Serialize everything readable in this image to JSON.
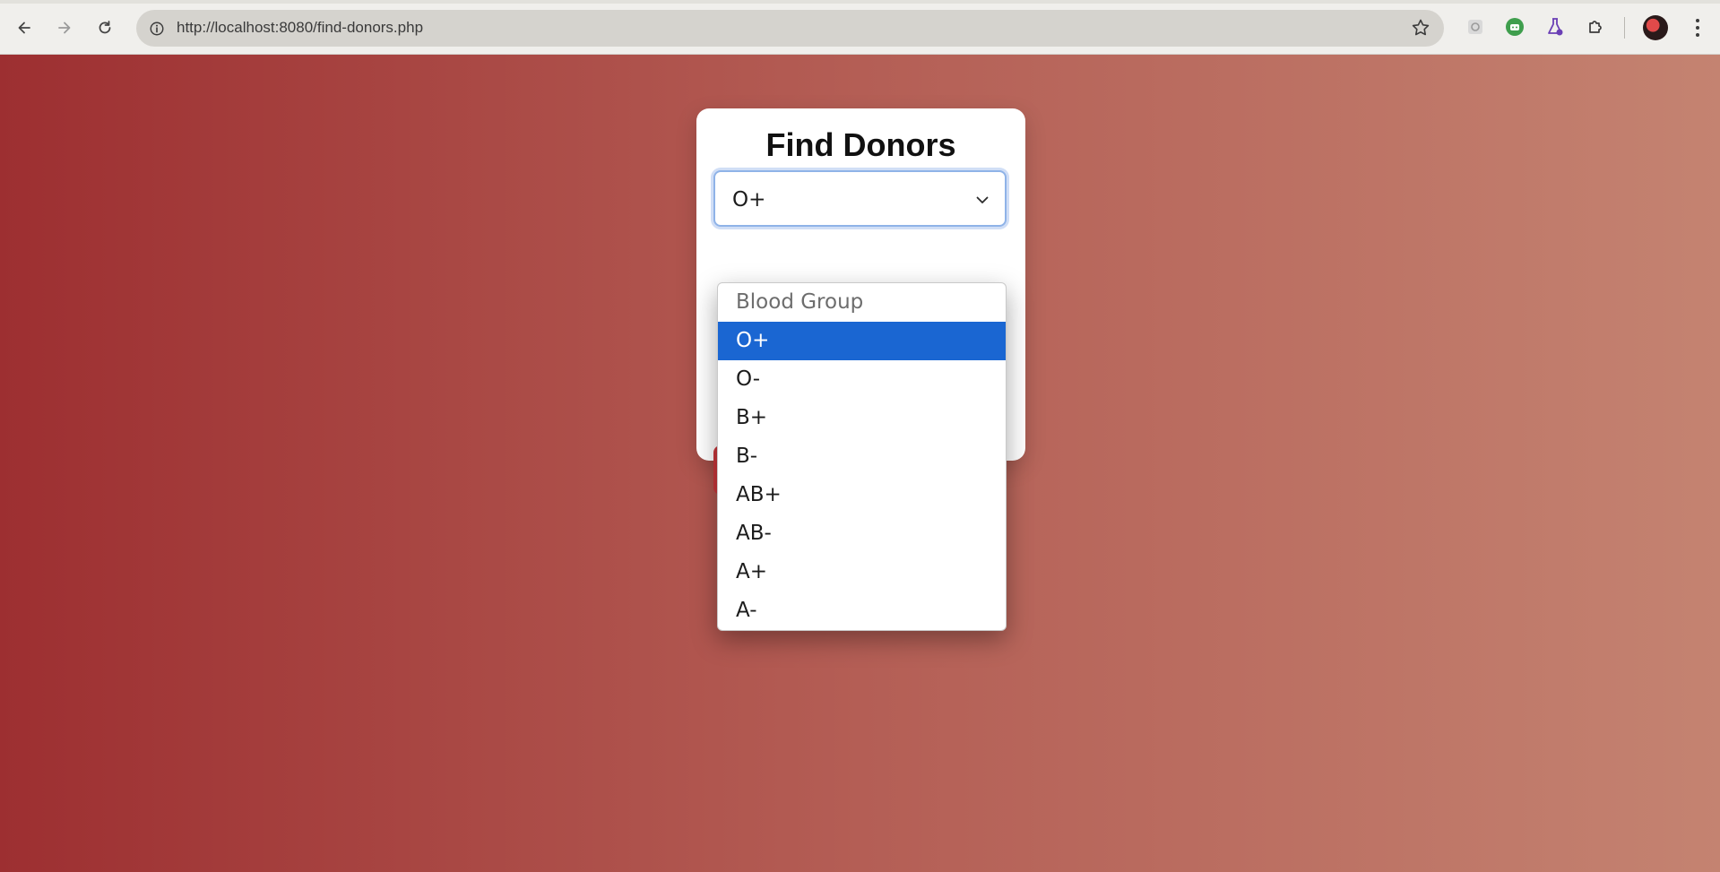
{
  "browser": {
    "url": "http://localhost:8080/find-donors.php",
    "back_icon": "back-arrow-icon",
    "forward_icon": "forward-arrow-icon",
    "reload_icon": "reload-icon",
    "bookmark_icon": "star-icon"
  },
  "page": {
    "title": "Find Donors",
    "blood_group_select": {
      "selected": "O+",
      "options": [
        "Blood Group",
        "O+",
        "O-",
        "B+",
        "B-",
        "AB+",
        "AB-",
        "A+",
        "A-"
      ]
    }
  },
  "colors": {
    "gradient_start": "#9d2f31",
    "gradient_end": "#c48371",
    "selected_option": "#1a66d2",
    "button_red": "#c9363b"
  }
}
